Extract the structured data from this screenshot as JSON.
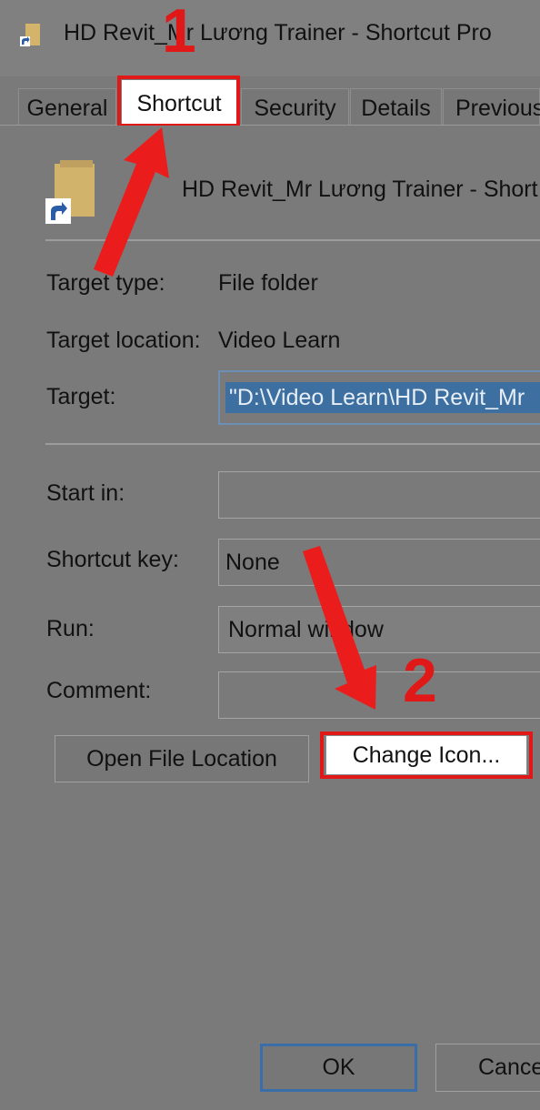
{
  "window": {
    "title": "HD Revit_Mr Lương Trainer - Shortcut Pro"
  },
  "tabs": [
    {
      "label": "General",
      "active": false
    },
    {
      "label": "Shortcut",
      "active": true
    },
    {
      "label": "Security",
      "active": false
    },
    {
      "label": "Details",
      "active": false
    },
    {
      "label": "Previous",
      "active": false
    }
  ],
  "shortcut": {
    "name": "HD Revit_Mr Lương Trainer - Short",
    "target_type_label": "Target type:",
    "target_type_value": "File folder",
    "target_location_label": "Target location:",
    "target_location_value": "Video Learn",
    "target_label": "Target:",
    "target_value": "\"D:\\Video Learn\\HD Revit_Mr",
    "start_in_label": "Start in:",
    "start_in_value": "",
    "shortcut_key_label": "Shortcut key:",
    "shortcut_key_value": "None",
    "run_label": "Run:",
    "run_value": "Normal window",
    "comment_label": "Comment:",
    "comment_value": ""
  },
  "buttons": {
    "open_file_location": "Open File Location",
    "change_icon": "Change Icon...",
    "ok": "OK",
    "cancel": "Cance"
  },
  "annotations": {
    "step1": "1",
    "step2": "2",
    "highlight_color": "#e01818"
  },
  "icons": {
    "title": "folder-shortcut-icon",
    "folder": "folder-icon",
    "shortcut_arrow": "shortcut-arrow-icon"
  }
}
